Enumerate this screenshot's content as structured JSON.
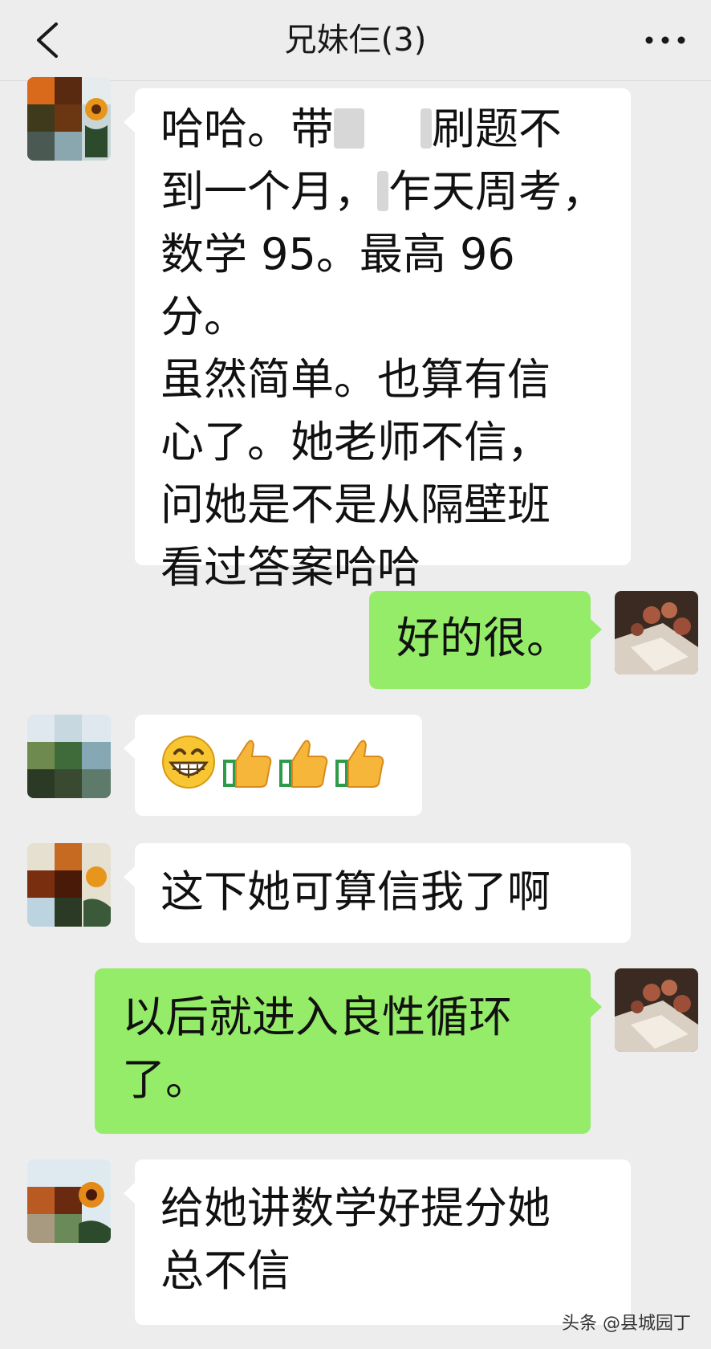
{
  "header": {
    "title": "兄妹仨(3)",
    "back_icon": "chevron-left-icon",
    "more_icon": "more-dots-icon"
  },
  "messages": [
    {
      "side": "left",
      "text_lines": [
        "哈哈。带",
        "刷题不",
        "到一个月，",
        "乍天周考，",
        "数学 95。最高 96 分。",
        "虽然简单。也算有信",
        "心了。她老师不信，",
        "问她是不是从隔壁班",
        "看过答案哈哈"
      ]
    },
    {
      "side": "right",
      "text": "好的很。"
    },
    {
      "side": "left",
      "emoji": [
        "grinning-face-icon",
        "thumbs-up-icon",
        "thumbs-up-icon",
        "thumbs-up-icon"
      ]
    },
    {
      "side": "left",
      "text": "这下她可算信我了啊"
    },
    {
      "side": "right",
      "text_lines": [
        "以后就进入良性循环",
        "了。"
      ]
    },
    {
      "side": "left",
      "text_lines": [
        "给她讲数学好提分她",
        "总不信"
      ]
    }
  ],
  "watermark": "头条 @县城园丁",
  "colors": {
    "background": "#ededed",
    "bubble_left": "#ffffff",
    "bubble_right": "#95ec69"
  }
}
